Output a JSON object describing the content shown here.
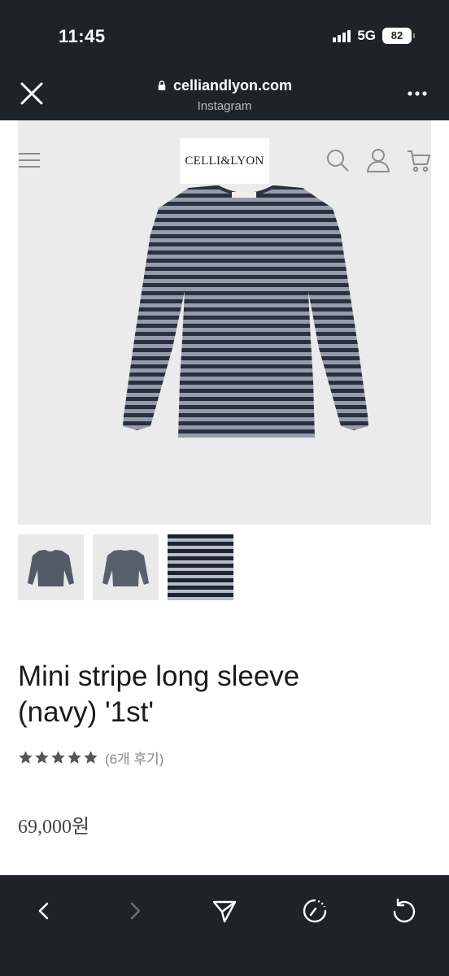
{
  "status_bar": {
    "time": "11:45",
    "network": "5G",
    "battery": "82"
  },
  "browser": {
    "url": "celliandlyon.com",
    "source": "Instagram",
    "close_icon": "close-icon",
    "more_icon": "more-icon"
  },
  "site": {
    "logo": "CELLI&LYON",
    "icons": [
      "menu-icon",
      "search-icon",
      "user-icon",
      "cart-icon"
    ]
  },
  "product": {
    "title_line1": "Mini stripe long sleeve",
    "title_line2": "(navy) '1st'",
    "rating_stars": 5,
    "review_text": "(6개 후기)",
    "price": "69,000원",
    "thumbnails": [
      "front-view",
      "back-view",
      "fabric-detail"
    ]
  },
  "colors": {
    "bar_bg": "#1f2229",
    "stripe_navy": "#2d3443",
    "stripe_light": "#9ea6b6",
    "hero_bg": "#ebebeb"
  },
  "bottom_nav": [
    "back-icon",
    "forward-icon",
    "share-icon",
    "timer-icon",
    "reload-icon"
  ]
}
